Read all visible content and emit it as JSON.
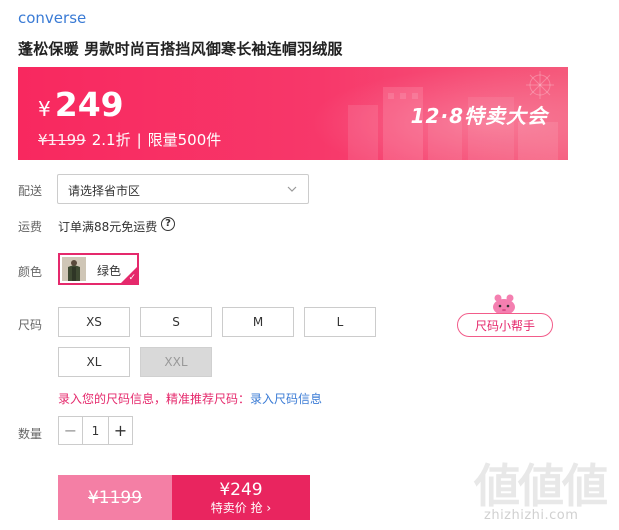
{
  "brand": "converse",
  "product_title": "蓬松保暖 男款时尚百搭挡风御寒长袖连帽羽绒服",
  "banner": {
    "currency": "¥",
    "price": "249",
    "original_price": "¥1199",
    "discount": "2.1折",
    "separator": "|",
    "limit": "限量500件",
    "event_title": "12·8特卖大会",
    "colors": {
      "start": "#f8285f",
      "end": "#f55a7c"
    }
  },
  "delivery": {
    "label": "配送",
    "placeholder_value": "请选择省市区"
  },
  "shipping": {
    "label": "运费",
    "text": "订单满88元免运费",
    "help_icon": "question-circle-icon"
  },
  "color": {
    "label": "颜色",
    "options": [
      {
        "name": "绿色",
        "selected": true
      }
    ]
  },
  "size": {
    "label": "尺码",
    "options": [
      {
        "name": "XS",
        "available": true
      },
      {
        "name": "S",
        "available": true
      },
      {
        "name": "M",
        "available": true
      },
      {
        "name": "L",
        "available": true
      },
      {
        "name": "XL",
        "available": true
      },
      {
        "name": "XXL",
        "available": false
      }
    ],
    "helper_button": "尺码小帮手",
    "tip_text": "录入您的尺码信息，精准推荐尺码：",
    "tip_link": "录入尺码信息"
  },
  "quantity": {
    "label": "数量",
    "value": "1",
    "minus": "−",
    "plus": "+"
  },
  "buy": {
    "original_price": "¥1199",
    "price": "¥249",
    "action_label": "特卖价 抢 ›",
    "accent_color": "#e9255f"
  },
  "watermark": {
    "glyphs": "値値値",
    "domain": "zhizhizhi.com"
  }
}
